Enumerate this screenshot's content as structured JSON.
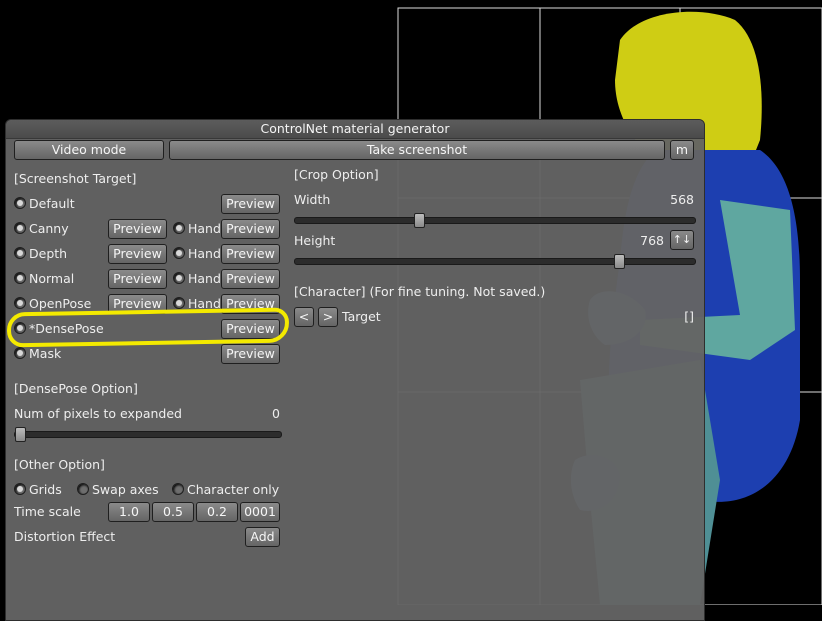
{
  "window": {
    "title": "ControlNet material generator"
  },
  "top_buttons": {
    "video_mode": "Video mode",
    "take_screenshot": "Take screenshot",
    "m": "m"
  },
  "screenshot_target": {
    "header": "[Screenshot Target]",
    "rows": [
      {
        "label": "Default",
        "on": true,
        "preview": "Preview"
      },
      {
        "label": "Canny",
        "on": true,
        "preview": "Preview",
        "hand": "Hand",
        "hand_preview": "Preview"
      },
      {
        "label": "Depth",
        "on": true,
        "preview": "Preview",
        "hand": "Hand",
        "hand_preview": "Preview"
      },
      {
        "label": "Normal",
        "on": true,
        "preview": "Preview",
        "hand": "Hand",
        "hand_preview": "Preview"
      },
      {
        "label": "OpenPose",
        "on": true,
        "preview": "Preview",
        "hand": "Hand",
        "hand_preview": "Preview"
      },
      {
        "label": "*DensePose",
        "on": true,
        "preview": "Preview"
      },
      {
        "label": "Mask",
        "on": true,
        "preview": "Preview"
      }
    ]
  },
  "densepose_option": {
    "header": "[DensePose Option]",
    "label": "Num of pixels to expanded",
    "value": "0",
    "slider_fraction": 0.0
  },
  "other_option": {
    "header": "[Other Option]",
    "grids": "Grids",
    "grids_on": true,
    "swap_axes": "Swap axes",
    "swap_on": false,
    "character_only": "Character only",
    "character_only_on": false,
    "time_scale": "Time scale",
    "time_values": [
      "1.0",
      "0.5",
      "0.2",
      "0001"
    ],
    "distortion": "Distortion Effect",
    "add": "Add"
  },
  "crop_option": {
    "header": "[Crop Option]",
    "width_label": "Width",
    "width_value": "568",
    "width_fraction": 0.305,
    "height_label": "Height",
    "height_value": "768",
    "height_fraction": 0.82,
    "swap_icon": "↑↓"
  },
  "character": {
    "header": "[Character] (For fine tuning. Not saved.)",
    "prev": "<",
    "next": ">",
    "target": "Target",
    "value": "[]"
  },
  "colors": {
    "highlight": "#f4ea00",
    "hair": "#d4d21a",
    "shirt": "#1a3fb0",
    "skin": "#5f7fb0"
  }
}
